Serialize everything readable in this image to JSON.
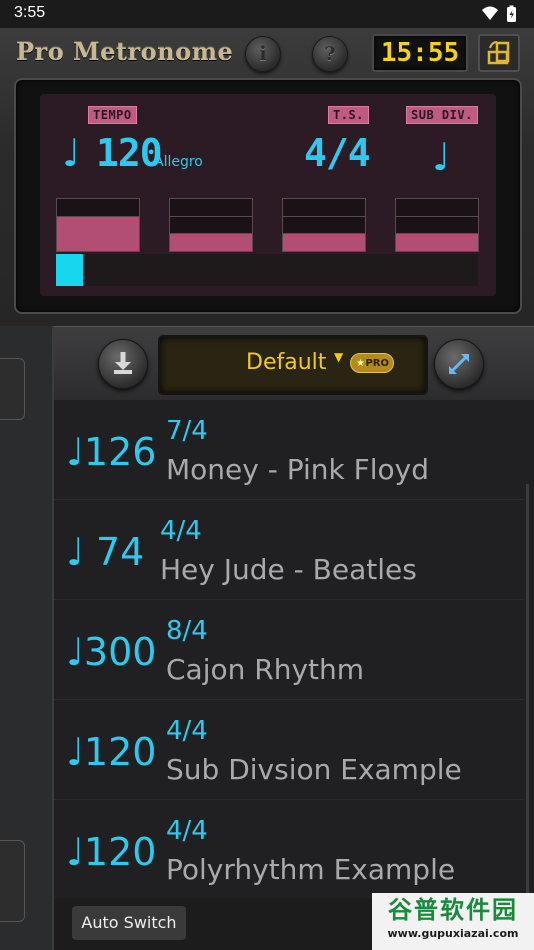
{
  "status_bar": {
    "time": "3:55"
  },
  "header": {
    "app_title": "Pro Metronome",
    "info_label": "i",
    "help_label": "?",
    "clock": "15:55"
  },
  "display": {
    "tempo_tag": "TEMPO",
    "ts_tag": "T.S.",
    "subdiv_tag": "SUB DIV.",
    "note_symbol": "♩",
    "tempo_value": "120",
    "tempo_name": "Allegro",
    "time_signature": "4/4",
    "subdiv_symbol": "♩",
    "beat_levels": [
      0.66,
      0.33,
      0.33,
      0.33
    ],
    "progress": 0.065
  },
  "toolbar": {
    "preset_label": "Default",
    "pro_badge": "PRO"
  },
  "presets": [
    {
      "tempo": "♩126",
      "signature": "7/4",
      "name": "Money - Pink Floyd"
    },
    {
      "tempo": "♩ 74",
      "signature": "4/4",
      "name": "Hey Jude - Beatles"
    },
    {
      "tempo": "♩300",
      "signature": "8/4",
      "name": "Cajon Rhythm"
    },
    {
      "tempo": "♩120",
      "signature": "4/4",
      "name": "Sub Divsion Example"
    },
    {
      "tempo": "♩120",
      "signature": "4/4",
      "name": "Polyrhythm Example"
    }
  ],
  "bottom": {
    "auto_switch": "Auto Switch"
  },
  "watermark": {
    "name": "谷普软件园",
    "url": "www.gupuxiazai.com"
  },
  "colors": {
    "accent_cyan": "#2ec9ee",
    "lcd_yellow": "#f3d21a",
    "tag_pink": "#c05a82"
  }
}
